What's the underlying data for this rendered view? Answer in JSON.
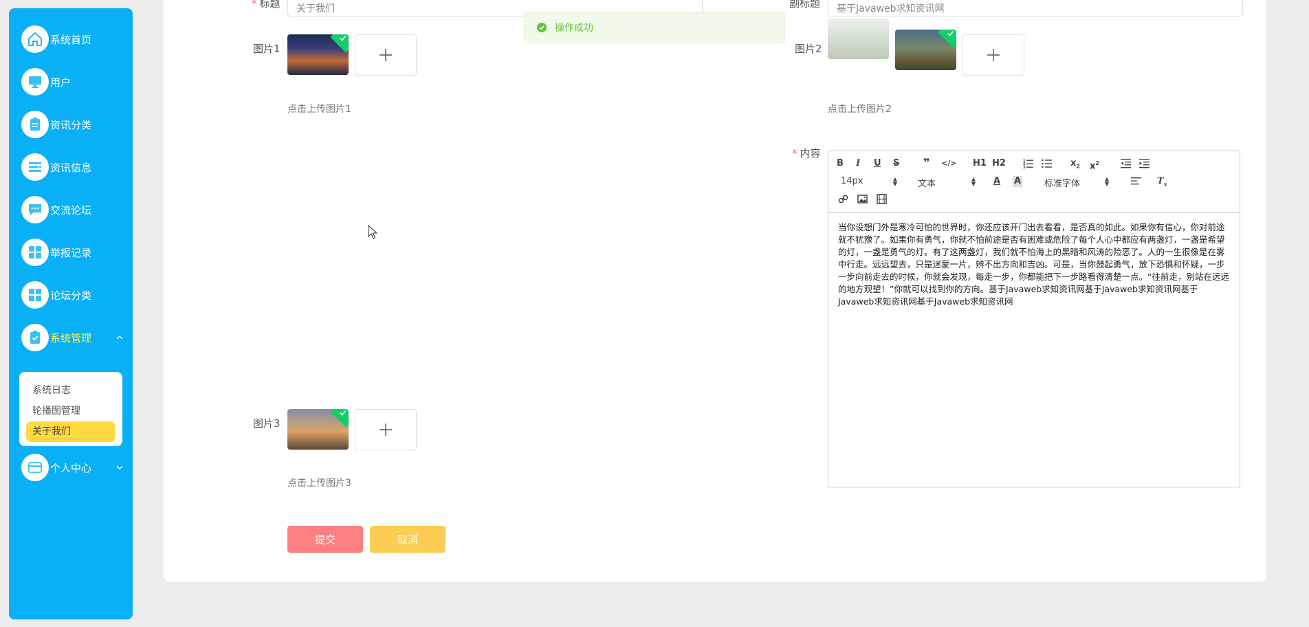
{
  "sidebar": {
    "items": [
      {
        "label": "系统首页",
        "icon": "home-icon"
      },
      {
        "label": "用户",
        "icon": "monitor-icon"
      },
      {
        "label": "资讯分类",
        "icon": "clipboard-icon"
      },
      {
        "label": "资讯信息",
        "icon": "list-icon"
      },
      {
        "label": "交流论坛",
        "icon": "chat-icon"
      },
      {
        "label": "举报记录",
        "icon": "grid-icon"
      },
      {
        "label": "论坛分类",
        "icon": "grid-icon"
      },
      {
        "label": "系统管理",
        "icon": "clipboard-check-icon"
      },
      {
        "label": "个人中心",
        "icon": "card-icon"
      }
    ],
    "submenu": [
      "系统日志",
      "轮播图管理",
      "关于我们"
    ]
  },
  "form": {
    "title_label": "标题",
    "title_value": "关于我们",
    "subtitle_label": "副标题",
    "subtitle_value": "基于Javaweb求知资讯网",
    "pic1_label": "图片1",
    "pic1_hint": "点击上传图片1",
    "pic2_label": "图片2",
    "pic2_hint": "点击上传图片2",
    "pic3_label": "图片3",
    "pic3_hint": "点击上传图片3",
    "content_label": "内容",
    "submit": "提交",
    "cancel": "取消"
  },
  "editor": {
    "font_size": "14px",
    "block_type": "文本",
    "font_family": "标准字体",
    "h1": "H1",
    "h2": "H2",
    "content": "当你设想门外是寒冷可怕的世界时，你还应该开门出去看看，是否真的如此。如果你有信心，你对前途就不犹豫了。如果你有勇气，你就不怕前途是否有困难或危险了每个人心中都应有两盏灯，一盏是希望的灯，一盏是勇气的灯。有了这两盏灯，我们就不怕海上的黑暗和风涛的险恶了。人的一生很像是在雾中行走。远远望去，只是迷蒙一片，辨不出方向和吉凶。可是，当你鼓起勇气，放下恐惧和怀疑，一步一步向前走去的时候，你就会发现，每走一步，你都能把下一步路看得清楚一点。“往前走，别站在远远的地方观望！”你就可以找到你的方向。基于Javaweb求知资讯网基于Javaweb求知资讯网基于Javaweb求知资讯网基于Javaweb求知资讯网"
  },
  "toast": {
    "message": "操作成功"
  },
  "colors": {
    "sidebar": "#0ab0f5",
    "active_text": "#fff34d",
    "active_sub": "#ffd93d",
    "submit": "#fc8081",
    "cancel": "#fccd52",
    "success": "#67c23a"
  }
}
